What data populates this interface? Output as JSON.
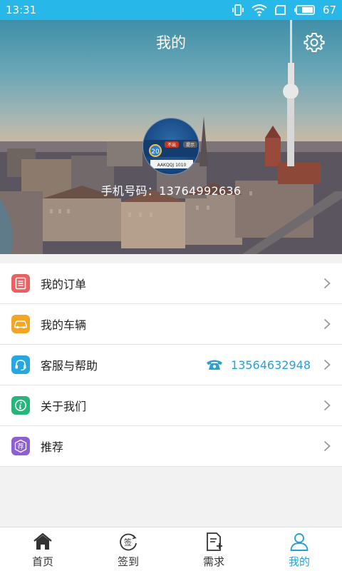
{
  "status_bar": {
    "time": "13:31",
    "battery": "67",
    "color": "#27b7e8"
  },
  "header": {
    "title": "我的",
    "settings_icon": "gear-icon",
    "avatar_image": "game-avatar",
    "phone_label": "手机号码：",
    "phone_number": "13764992636"
  },
  "menu": {
    "items": [
      {
        "label": "我的订单",
        "icon": "order-icon",
        "color": "#e8605f"
      },
      {
        "label": "我的车辆",
        "icon": "car-icon",
        "color": "#f3a524"
      },
      {
        "label": "客服与帮助",
        "icon": "headset-icon",
        "color": "#27a7e0",
        "extra_number": "13564632948",
        "extra_icon": "telephone-icon"
      },
      {
        "label": "关于我们",
        "icon": "info-icon",
        "color": "#27b57b"
      },
      {
        "label": "推荐",
        "icon": "recommend-icon",
        "color": "#8d5fd3",
        "icon_text": "荐"
      }
    ]
  },
  "tabbar": {
    "tabs": [
      {
        "label": "首页",
        "icon": "home-icon"
      },
      {
        "label": "签到",
        "icon": "sign-in-icon",
        "icon_text": "签"
      },
      {
        "label": "需求",
        "icon": "requirement-icon"
      },
      {
        "label": "我的",
        "icon": "user-icon",
        "active": true
      }
    ],
    "active_color": "#27a0d6"
  },
  "avatar_badge": {
    "number": "20",
    "btn1": "不出",
    "btn2": "提示",
    "cards": "AAKQQJ 1010"
  }
}
